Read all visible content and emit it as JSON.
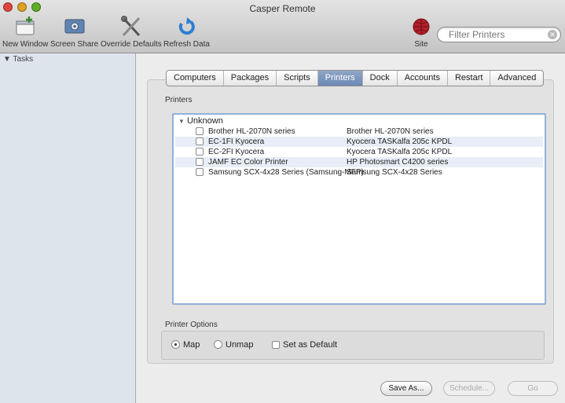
{
  "window": {
    "title": "Casper Remote"
  },
  "toolbar": {
    "new_window": "New Window",
    "screen_share": "Screen Share",
    "override_defaults": "Override Defaults",
    "refresh_data": "Refresh Data",
    "site": "Site",
    "filter_placeholder": "Filter Printers"
  },
  "sidebar": {
    "header": "Tasks"
  },
  "tabs": [
    "Computers",
    "Packages",
    "Scripts",
    "Printers",
    "Dock",
    "Accounts",
    "Restart",
    "Advanced"
  ],
  "active_tab": "Printers",
  "printers_section": {
    "label": "Printers",
    "group": "Unknown",
    "rows": [
      {
        "name": "Brother HL-2070N series",
        "model": "Brother HL-2070N series"
      },
      {
        "name": "EC-1FI Kyocera",
        "model": "Kyocera TASKalfa 205c KPDL"
      },
      {
        "name": "EC-2FI Kyocera",
        "model": "Kyocera TASKalfa 205c KPDL"
      },
      {
        "name": "JAMF EC Color Printer",
        "model": "HP Photosmart C4200 series"
      },
      {
        "name": "Samsung SCX-4x28 Series (Samsung-MFP)",
        "model": "Samsung SCX-4x28 Series"
      }
    ]
  },
  "printer_options": {
    "label": "Printer Options",
    "map": "Map",
    "unmap": "Unmap",
    "set_default": "Set as Default",
    "selected": "Map"
  },
  "buttons": {
    "save_as": "Save As...",
    "schedule": "Schedule...",
    "go": "Go"
  },
  "colors": {
    "active_tab": "#7089b6",
    "list_border": "#8fb1dc",
    "row_alt": "#e8edf7",
    "sidebar": "#dee4ec"
  }
}
